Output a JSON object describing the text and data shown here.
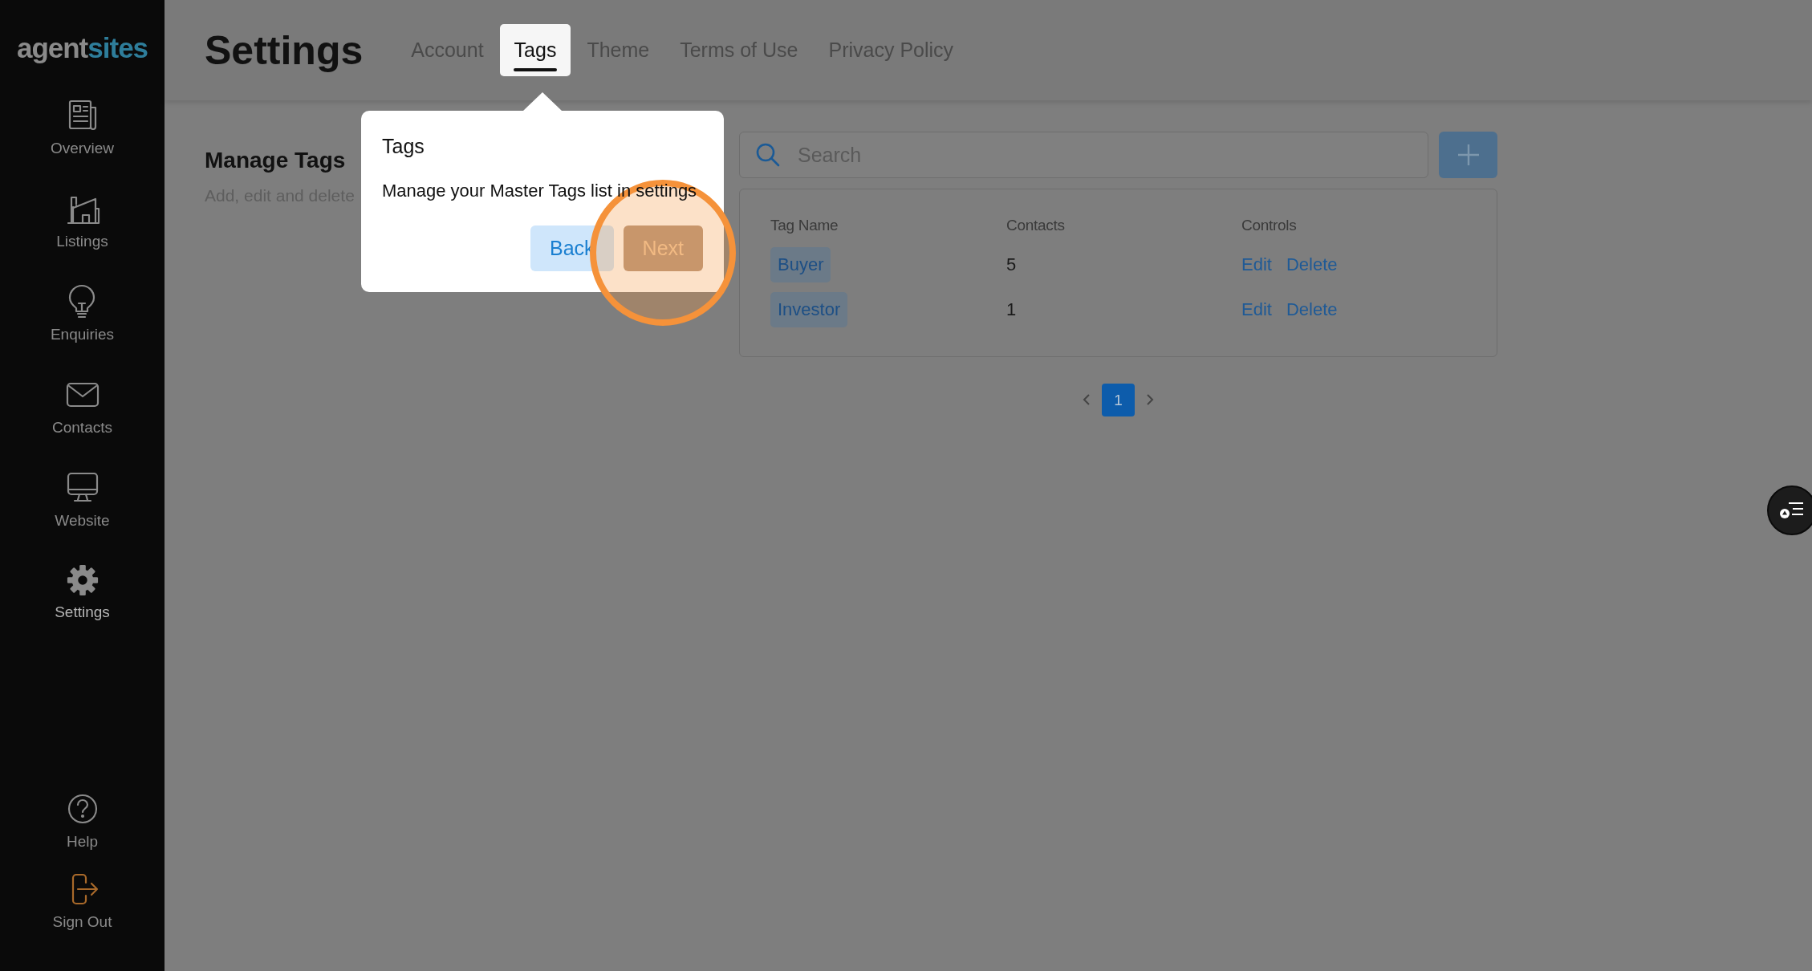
{
  "logo": {
    "part_1": "agent",
    "part_2": "sites"
  },
  "sidebar": {
    "items": [
      {
        "label": "Overview",
        "selected": false
      },
      {
        "label": "Listings",
        "selected": false
      },
      {
        "label": "Enquiries",
        "selected": false
      },
      {
        "label": "Contacts",
        "selected": false
      },
      {
        "label": "Website",
        "selected": false
      },
      {
        "label": "Settings",
        "selected": true
      }
    ],
    "footer_items": [
      {
        "label": "Help"
      },
      {
        "label": "Sign Out"
      }
    ]
  },
  "header": {
    "title": "Settings",
    "tabs": [
      {
        "label": "Account",
        "selected": false
      },
      {
        "label": "Tags",
        "selected": true
      },
      {
        "label": "Theme",
        "selected": false
      },
      {
        "label": "Terms of Use",
        "selected": false
      },
      {
        "label": "Privacy Policy",
        "selected": false
      }
    ]
  },
  "manage": {
    "title": "Manage Tags",
    "subtitle": "Add, edit and delete"
  },
  "search": {
    "placeholder": "Search"
  },
  "table": {
    "columns": [
      "Tag Name",
      "Contacts",
      "Controls"
    ],
    "rows": [
      {
        "tag": "Buyer",
        "contacts": "5",
        "actions": [
          "Edit",
          "Delete"
        ]
      },
      {
        "tag": "Investor",
        "contacts": "1",
        "actions": [
          "Edit",
          "Delete"
        ]
      }
    ]
  },
  "pagination": {
    "pages": [
      {
        "label": "1",
        "selected": true
      }
    ]
  },
  "tour": {
    "title": "Tags",
    "body": "Manage your Master Tags list in settings",
    "buttons": [
      {
        "label": "Back",
        "kind": "back"
      },
      {
        "label": "Next",
        "kind": "next"
      }
    ]
  }
}
